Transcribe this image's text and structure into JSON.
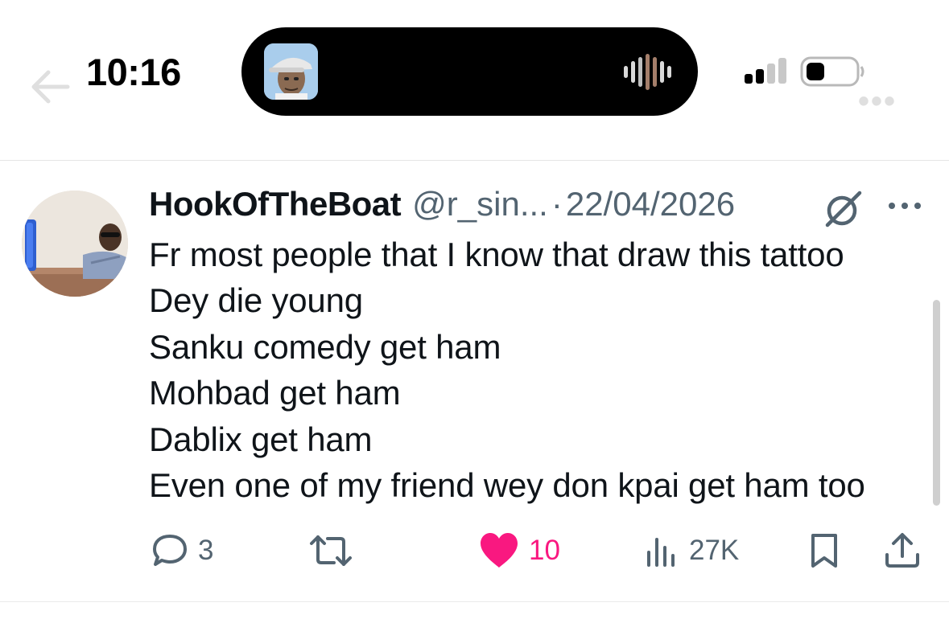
{
  "status_bar": {
    "time": "10:16",
    "island_activity_icon": "waveform-icon",
    "signal_icon": "cellular-signal-icon",
    "battery_icon": "battery-icon"
  },
  "nav": {
    "back_icon": "arrow-left-icon",
    "more_icon": "more-horizontal-icon"
  },
  "tweet": {
    "display_name": "HookOfTheBoat",
    "handle": "@r_sin...",
    "separator": "·",
    "date": "22/04/2026",
    "grok_icon": "grok-icon",
    "more_icon": "more-horizontal-icon",
    "lines": [
      "Fr most people that I know that draw this tattoo",
      "Dey die young",
      "Sanku comedy get ham",
      "Mohbad get ham",
      "Dablix get ham",
      "Even one of my friend wey don kpai get ham too"
    ],
    "actions": {
      "replies": "3",
      "reposts": "",
      "likes": "10",
      "views": "27K"
    },
    "liked": true
  },
  "colors": {
    "text": "#0f1419",
    "secondary": "#536471",
    "like": "#f91880",
    "island": "#000000"
  }
}
